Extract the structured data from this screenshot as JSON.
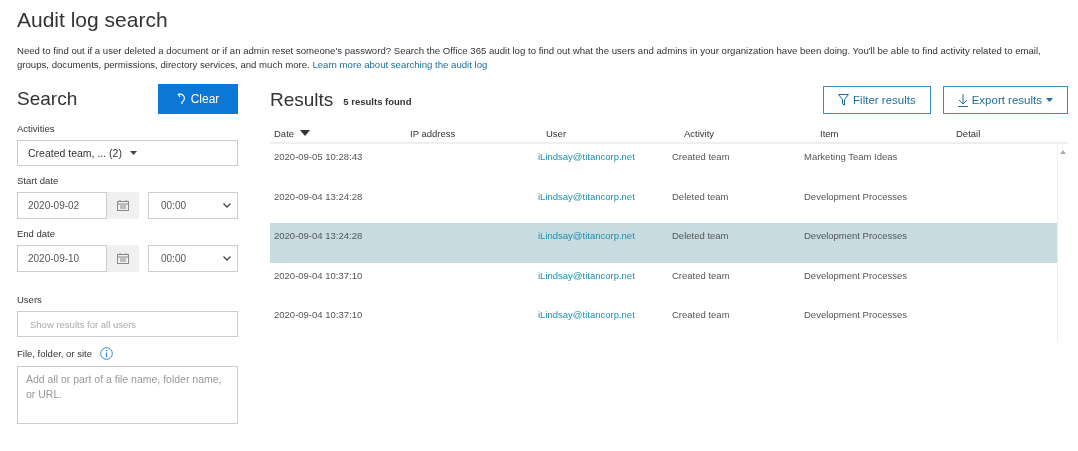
{
  "title": "Audit log search",
  "description": {
    "text": "Need to find out if a user deleted a document or if an admin reset someone's password? Search the Office 365 audit log to find out what the users and admins in your organization have been doing. You'll be able to find activity related to email, groups, documents, permissions, directory services, and much more.",
    "link": "Learn more about searching the audit log"
  },
  "search": {
    "heading": "Search",
    "clear_button": "Clear",
    "activities": {
      "label": "Activities",
      "value": "Created team, ... (2)"
    },
    "start_date": {
      "label": "Start date",
      "date": "2020-09-02",
      "time": "00:00"
    },
    "end_date": {
      "label": "End date",
      "date": "2020-09-10",
      "time": "00:00"
    },
    "users": {
      "label": "Users",
      "placeholder": "Show results for all users"
    },
    "file_folder_site": {
      "label": "File, folder, or site",
      "placeholder": "Add all or part of a file name, folder name, or URL."
    }
  },
  "results": {
    "heading": "Results",
    "count": "5 results found",
    "filter_button": "Filter results",
    "export_button": "Export results",
    "table": {
      "columns": [
        "Date",
        "IP address",
        "User",
        "Activity",
        "Item",
        "Detail"
      ],
      "rows": [
        {
          "date": "2020-09-05 10:28:43",
          "user": "iLindsay@titancorp.net",
          "activity": "Created team",
          "item": "Marketing Team Ideas",
          "selected": false
        },
        {
          "date": "2020-09-04 13:24:28",
          "user": "iLindsay@titancorp.net",
          "activity": "Deleted team",
          "item": "Development Processes",
          "selected": false
        },
        {
          "date": "2020-09-04 13:24:28",
          "user": "iLindsay@titancorp.net",
          "activity": "Deleted team",
          "item": "Development Processes",
          "selected": true
        },
        {
          "date": "2020-09-04 10:37:10",
          "user": "iLindsay@titancorp.net",
          "activity": "Created team",
          "item": "Development Processes",
          "selected": false
        },
        {
          "date": "2020-09-04 10:37:10",
          "user": "iLindsay@titancorp.net",
          "activity": "Created team",
          "item": "Development Processes",
          "selected": false
        }
      ]
    }
  }
}
